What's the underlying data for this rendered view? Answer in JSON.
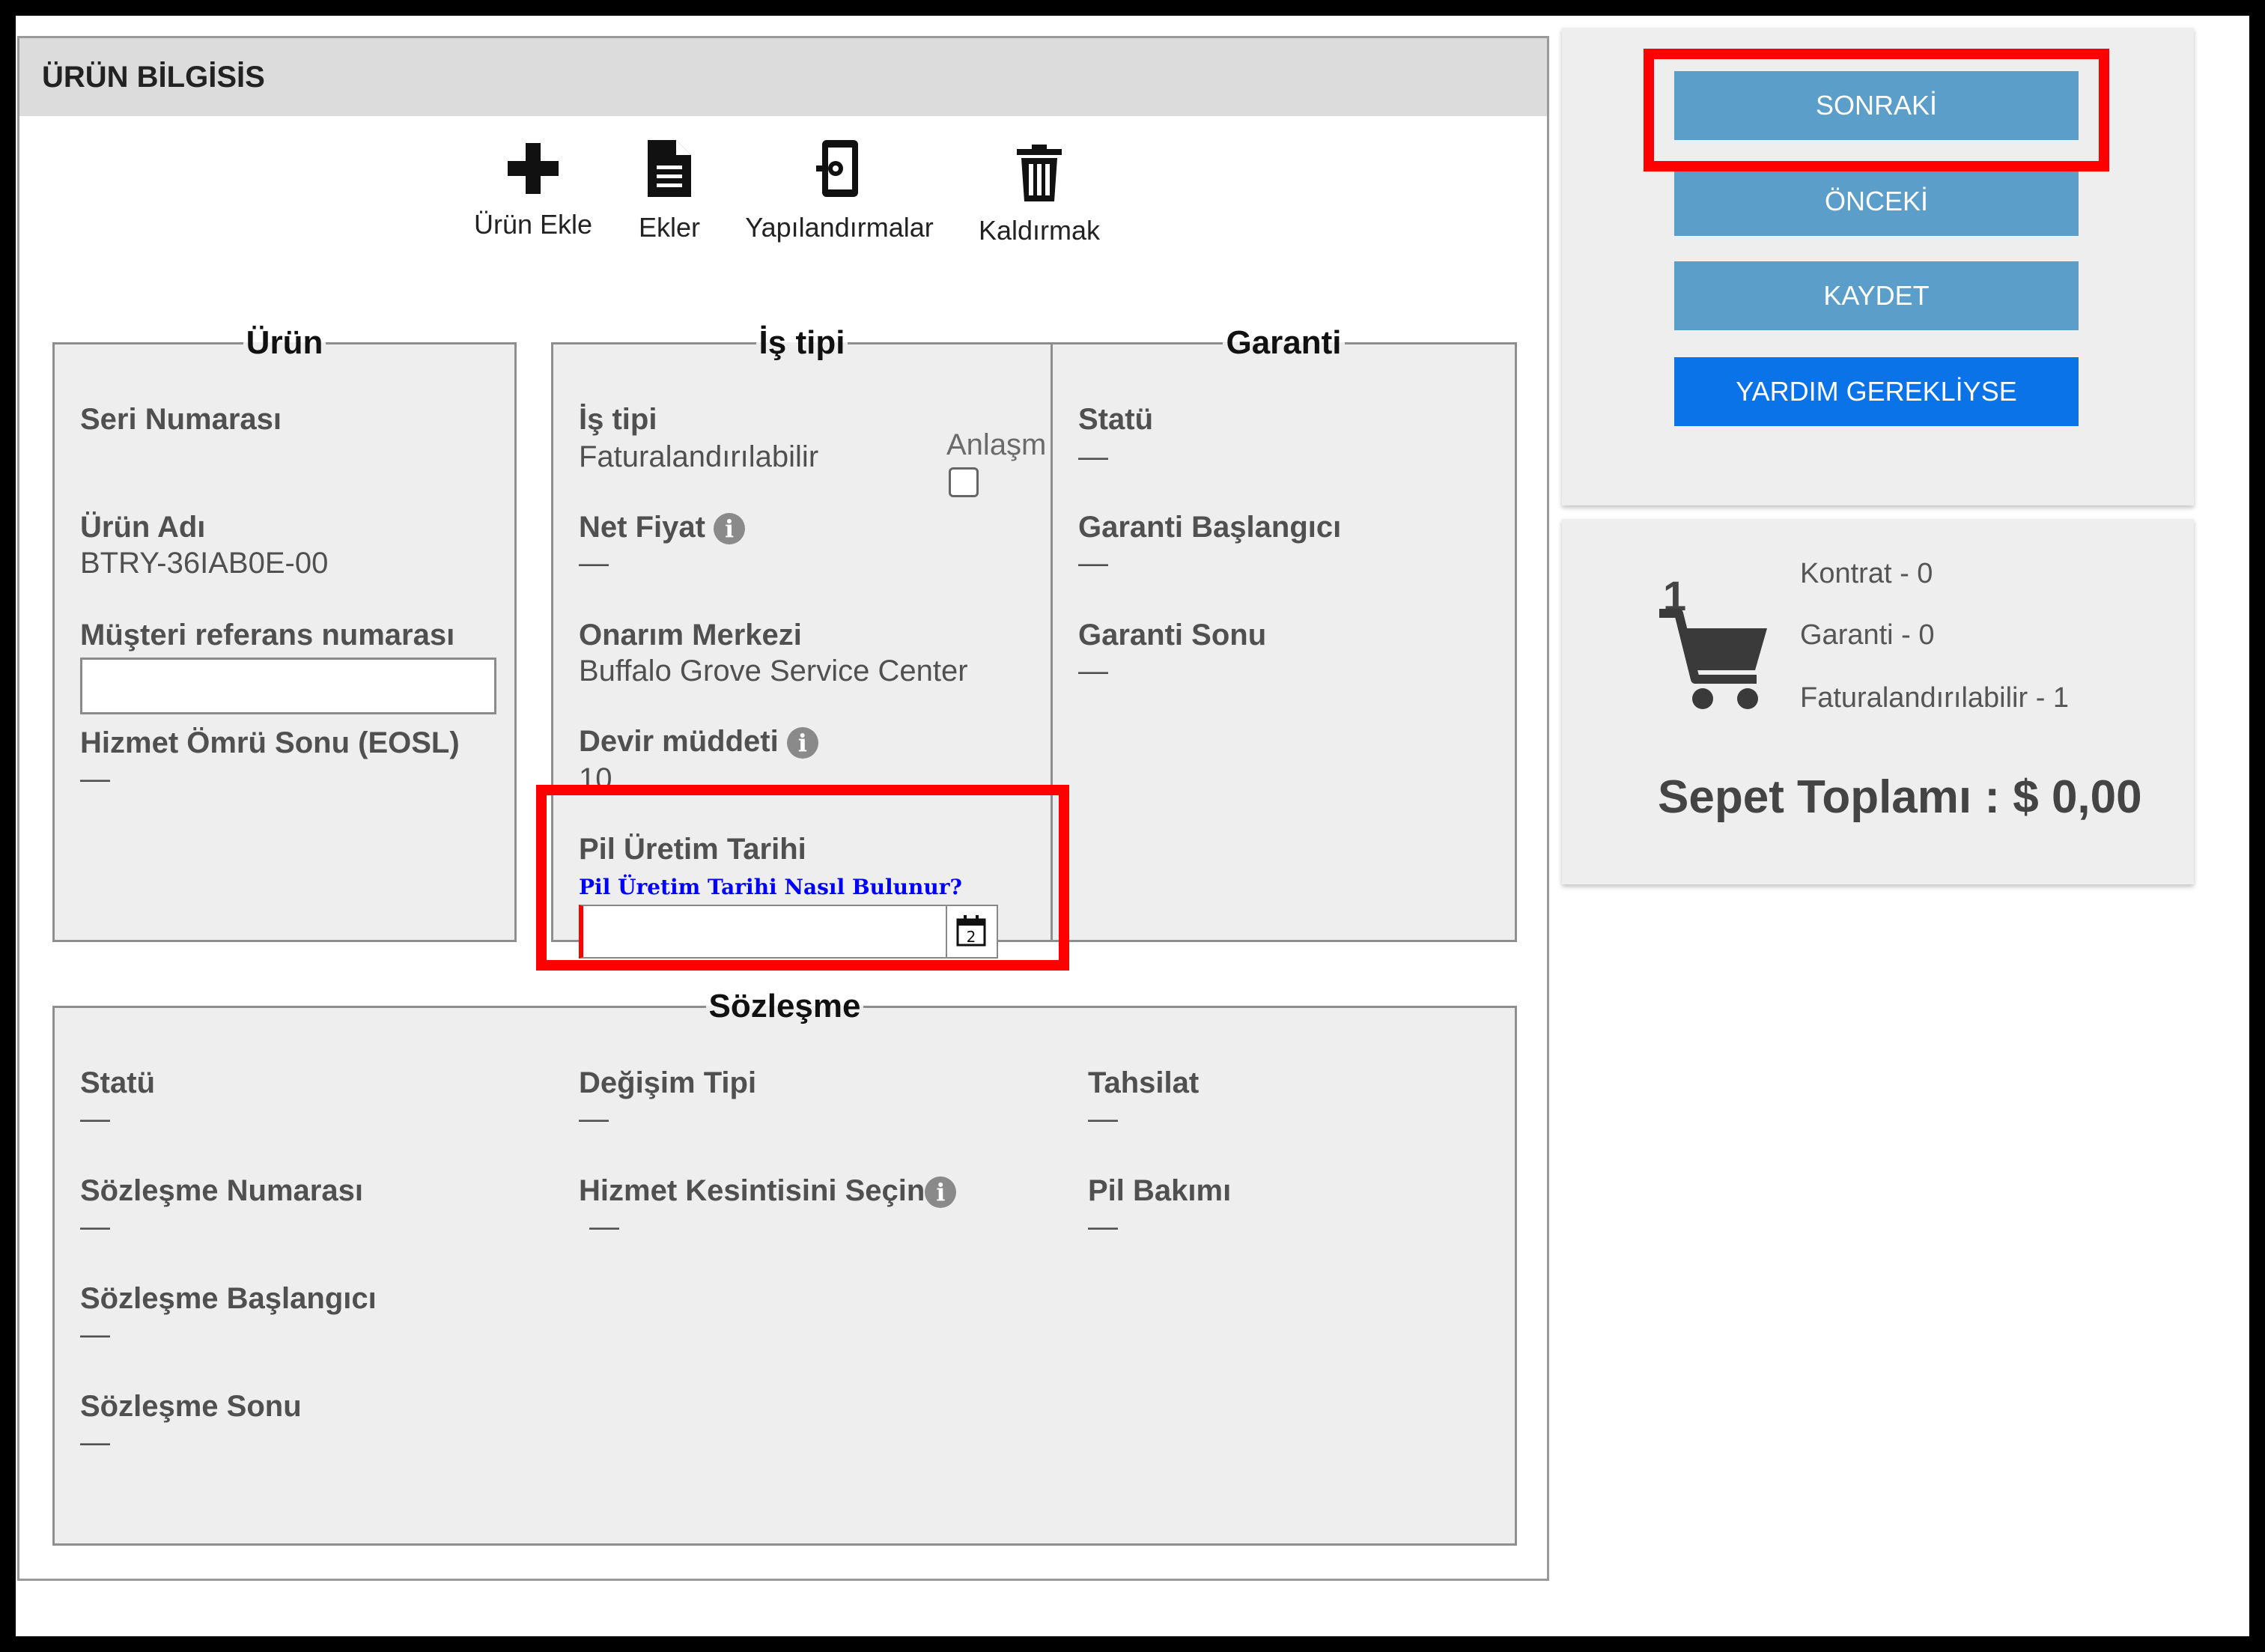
{
  "panel": {
    "title": "ÜRÜN BİLGİSİS"
  },
  "toolbar": {
    "add_product": "Ürün Ekle",
    "attachments": "Ekler",
    "configurations": "Yapılandırmalar",
    "remove": "Kaldırmak"
  },
  "product": {
    "legend": "Ürün",
    "serial_label": "Seri Numarası",
    "name_label": "Ürün Adı",
    "name_value": "BTRY-36IAB0E-00",
    "customer_ref_label": "Müşteri referans numarası",
    "customer_ref_value": "",
    "eosl_label": "Hizmet Ömrü Sonu (EOSL)",
    "eosl_value": "—"
  },
  "business_type": {
    "legend": "İş tipi",
    "type_label": "İş tipi",
    "type_value": "Faturalandırılabilir",
    "agreement_label": "Anlaşm",
    "net_price_label": "Net Fiyat",
    "net_price_value": "—",
    "repair_center_label": "Onarım Merkezi",
    "repair_center_value": "Buffalo Grove Service Center",
    "turnaround_label": "Devir müddeti",
    "turnaround_value": "10",
    "battery_date_label": "Pil Üretim Tarihi",
    "battery_date_help": "Pil Üretim Tarihi Nasıl Bulunur?",
    "battery_date_value": "",
    "calendar_day": "2"
  },
  "warranty": {
    "legend": "Garanti",
    "status_label": "Statü",
    "status_value": "—",
    "start_label": "Garanti Başlangıcı",
    "start_value": "—",
    "end_label": "Garanti Sonu",
    "end_value": "—"
  },
  "contract": {
    "legend": "Sözleşme",
    "status_label": "Statü",
    "status_value": "—",
    "number_label": "Sözleşme Numarası",
    "number_value": "—",
    "start_label": "Sözleşme Başlangıcı",
    "start_value": "—",
    "end_label": "Sözleşme Sonu",
    "end_value": "—",
    "exchange_label": "Değişim Tipi",
    "exchange_value": "—",
    "service_cut_label": "Hizmet Kesintisini Seçin",
    "service_cut_value": "—",
    "collection_label": "Tahsilat",
    "collection_value": "—",
    "battery_maint_label": "Pil Bakımı",
    "battery_maint_value": "—"
  },
  "actions": {
    "next": "SONRAKİ",
    "previous": "ÖNCEKİ",
    "save": "KAYDET",
    "help": "YARDIM GEREKLİYSE"
  },
  "cart": {
    "count": "1",
    "contract_line": "Kontrat - 0",
    "warranty_line": "Garanti - 0",
    "billable_line": "Faturalandırılabilir - 1",
    "total": "Sepet Toplamı : $ 0,00"
  },
  "colors": {
    "button_blue": "#5b9ec9",
    "help_blue": "#0a73e8",
    "highlight_red": "#ff0000",
    "link_blue": "#0000ff"
  }
}
